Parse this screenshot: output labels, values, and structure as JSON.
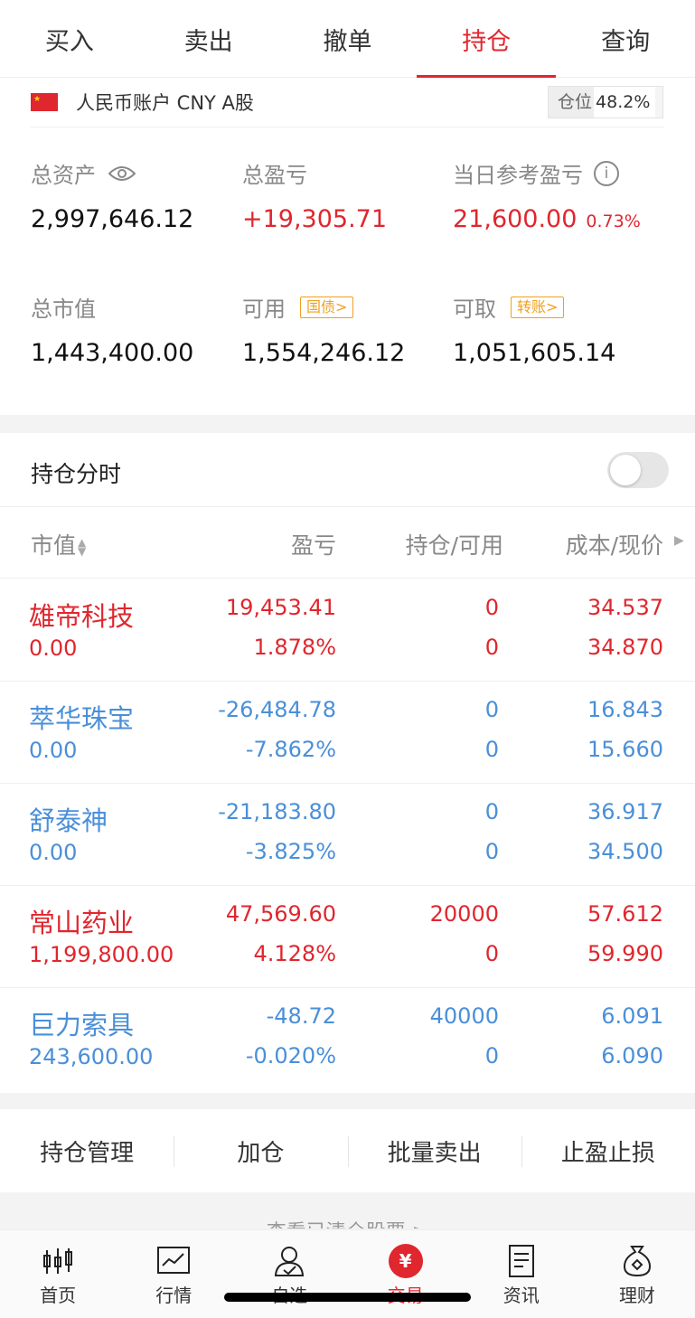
{
  "tabs": [
    {
      "label": "买入"
    },
    {
      "label": "卖出"
    },
    {
      "label": "撤单"
    },
    {
      "label": "持仓",
      "active": true
    },
    {
      "label": "查询"
    }
  ],
  "account": {
    "flag_icon": "china-flag-icon",
    "label": "人民币账户 CNY A股",
    "position_label": "仓位",
    "position_value": "48.2%"
  },
  "summary": {
    "total_assets_label": "总资产",
    "total_assets_value": "2,997,646.12",
    "total_pl_label": "总盈亏",
    "total_pl_value": "+19,305.71",
    "daily_pl_label": "当日参考盈亏",
    "daily_pl_value": "21,600.00",
    "daily_pl_pct": "0.73%",
    "market_value_label": "总市值",
    "market_value_value": "1,443,400.00",
    "available_label": "可用",
    "available_tag": "国债>",
    "available_value": "1,554,246.12",
    "withdrawable_label": "可取",
    "withdrawable_tag": "转账>",
    "withdrawable_value": "1,051,605.14"
  },
  "fenshi": {
    "label": "持仓分时",
    "enabled": false
  },
  "table": {
    "headers": {
      "market_value": "市值",
      "pl": "盈亏",
      "holding": "持仓/可用",
      "price": "成本/现价"
    },
    "rows": [
      {
        "name": "雄帝科技",
        "market_value": "0.00",
        "pl": "19,453.41",
        "pl_pct": "1.878%",
        "holding": "0",
        "available": "0",
        "cost": "34.537",
        "price": "34.870",
        "trend": "up"
      },
      {
        "name": "萃华珠宝",
        "market_value": "0.00",
        "pl": "-26,484.78",
        "pl_pct": "-7.862%",
        "holding": "0",
        "available": "0",
        "cost": "16.843",
        "price": "15.660",
        "trend": "down"
      },
      {
        "name": "舒泰神",
        "market_value": "0.00",
        "pl": "-21,183.80",
        "pl_pct": "-3.825%",
        "holding": "0",
        "available": "0",
        "cost": "36.917",
        "price": "34.500",
        "trend": "down"
      },
      {
        "name": "常山药业",
        "market_value": "1,199,800.00",
        "pl": "47,569.60",
        "pl_pct": "4.128%",
        "holding": "20000",
        "available": "0",
        "cost": "57.612",
        "price": "59.990",
        "trend": "up"
      },
      {
        "name": "巨力索具",
        "market_value": "243,600.00",
        "pl": "-48.72",
        "pl_pct": "-0.020%",
        "holding": "40000",
        "available": "0",
        "cost": "6.091",
        "price": "6.090",
        "trend": "down"
      }
    ]
  },
  "actions": [
    "持仓管理",
    "加仓",
    "批量卖出",
    "止盈止损"
  ],
  "cleared_link": "查看已清仓股票 >",
  "nav": [
    {
      "label": "首页",
      "icon": "candlestick-icon"
    },
    {
      "label": "行情",
      "icon": "chart-icon"
    },
    {
      "label": "自选",
      "icon": "user-check-icon"
    },
    {
      "label": "交易",
      "icon": "yen-icon",
      "active": true
    },
    {
      "label": "资讯",
      "icon": "document-icon"
    },
    {
      "label": "理财",
      "icon": "money-bag-icon"
    }
  ],
  "colors": {
    "up": "#e0262e",
    "down": "#4a8fd9",
    "accent": "#e0262e",
    "tag": "#f0a020"
  }
}
